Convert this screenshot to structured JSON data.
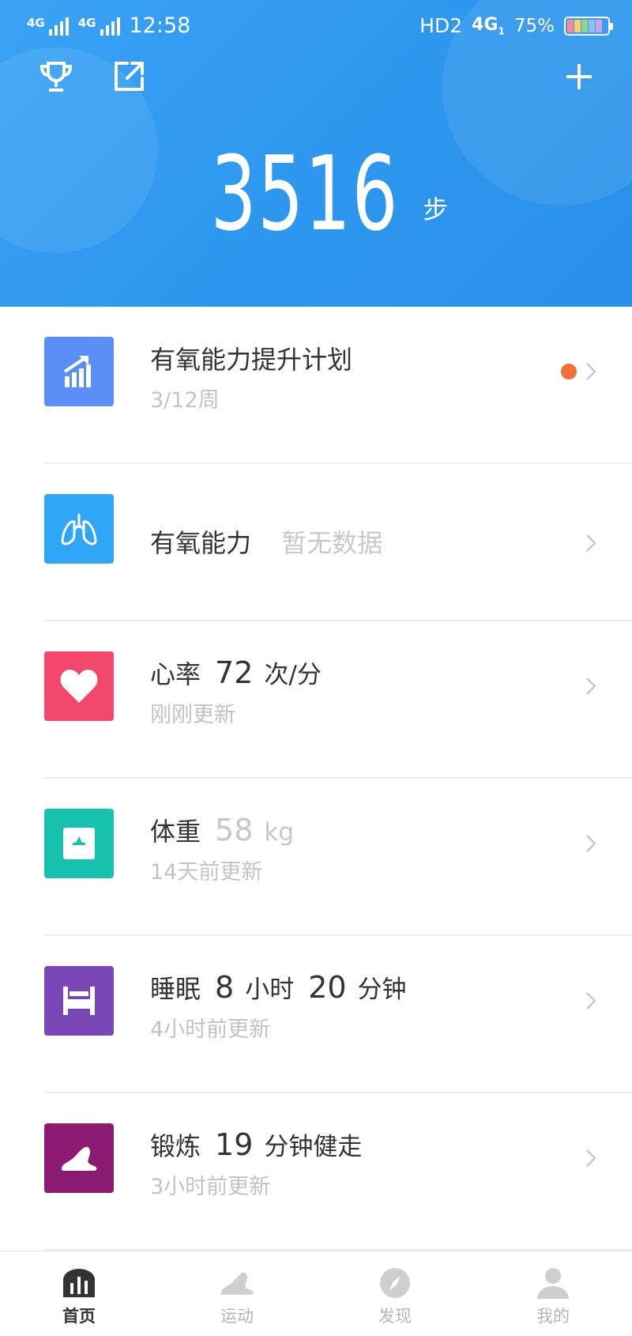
{
  "status_bar": {
    "signal1_label": "4G",
    "signal2_label": "4G",
    "time": "12:58",
    "hd_label": "HD2",
    "network": "4G",
    "network_sub": "1",
    "battery": "75%"
  },
  "header": {
    "steps": "3516",
    "steps_unit": "步",
    "trophy_icon": "trophy-icon",
    "share_icon": "share-icon",
    "add_icon": "plus-icon"
  },
  "cards": [
    {
      "icon": "bar-chart-up-icon",
      "color": "#5b8ff5",
      "title": "有氧能力提升计划",
      "sub": "3/12周",
      "has_dot": true
    },
    {
      "icon": "lungs-icon",
      "color": "#30a7f6",
      "title": "有氧能力",
      "status": "暂无数据"
    },
    {
      "icon": "heart-icon",
      "color": "#f1486c",
      "title": "心率",
      "value": "72",
      "unit": "次/分",
      "sub": "刚刚更新"
    },
    {
      "icon": "scale-icon",
      "color": "#18c2b0",
      "title": "体重",
      "value": "58",
      "unit": "kg",
      "sub": "14天前更新"
    },
    {
      "icon": "bed-icon",
      "color": "#7a47b7",
      "title": "睡眠",
      "value": "8",
      "unit": "小时",
      "value2": "20",
      "unit2": "分钟",
      "sub": "4小时前更新"
    },
    {
      "icon": "shoe-icon",
      "color": "#8a1a72",
      "title": "锻炼",
      "value": "19",
      "unit": "分钟健走",
      "sub": "3小时前更新"
    }
  ],
  "tabs": [
    {
      "label": "首页",
      "icon": "home-chart-icon",
      "active": true
    },
    {
      "label": "运动",
      "icon": "shoe-icon",
      "active": false
    },
    {
      "label": "发现",
      "icon": "compass-icon",
      "active": false
    },
    {
      "label": "我的",
      "icon": "person-icon",
      "active": false
    }
  ],
  "colors": {
    "header": "#2d96ee",
    "accent_dot": "#f0703a"
  }
}
